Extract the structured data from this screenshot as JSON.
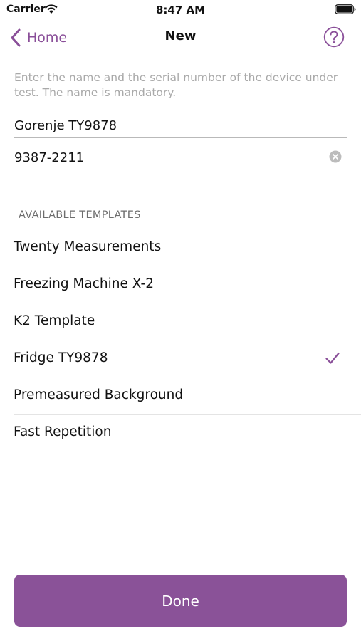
{
  "status_bar": {
    "carrier": "Carrier",
    "time": "8:47 AM"
  },
  "nav": {
    "back_label": "Home",
    "title": "New",
    "help_icon": "question-circle-icon"
  },
  "instructions": "Enter the name and the serial number of the device under test. The name is mandatory.",
  "fields": {
    "name_value": "Gorenje TY9878",
    "serial_value": "9387-2211"
  },
  "templates": {
    "header": "AVAILABLE TEMPLATES",
    "items": [
      {
        "label": "Twenty Measurements",
        "selected": false
      },
      {
        "label": "Freezing Machine X-2",
        "selected": false
      },
      {
        "label": "K2 Template",
        "selected": false
      },
      {
        "label": "Fridge TY9878",
        "selected": true
      },
      {
        "label": "Premeasured Background",
        "selected": false
      },
      {
        "label": "Fast Repetition",
        "selected": false
      }
    ]
  },
  "done_label": "Done",
  "colors": {
    "accent": "#8a4f99",
    "button": "#8a5298"
  }
}
